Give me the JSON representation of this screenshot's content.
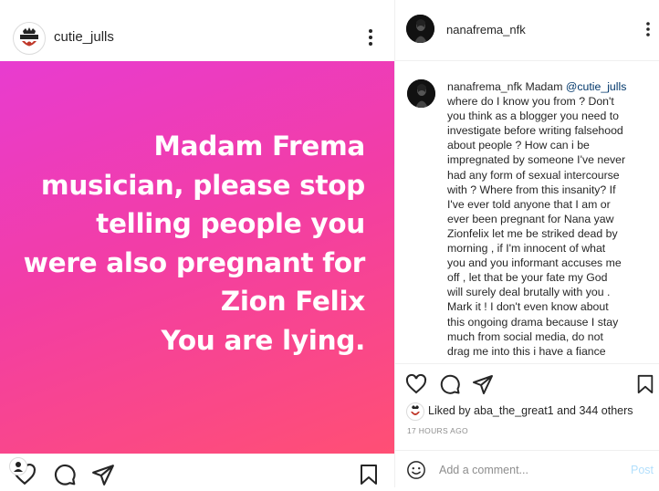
{
  "left": {
    "username": "cutie_julls",
    "avatar_text": "CUTIE",
    "post_text_lines": [
      "Madam Frema",
      "musician, please stop",
      "telling people you",
      "were also pregnant for",
      "Zion Felix",
      "You are lying."
    ]
  },
  "right": {
    "username": "nanafrema_nfk",
    "caption": {
      "username": "nanafrema_nfk",
      "text_before_mention": "Madam",
      "mention": "@cutie_julls",
      "lines": [
        "where do I know you from ? Don't",
        "you think as a blogger you need to",
        "investigate before writing falsehood",
        "about people ? How can i be",
        "impregnated by someone I've never",
        "had any form of sexual intercourse",
        "with ? Where from this insanity? If",
        "I've ever told anyone that I am or",
        "ever been pregnant for Nana yaw",
        "Zionfelix let me be striked dead by",
        "morning , if I'm innocent of what",
        "you and you informant accuses me",
        "off , let that be your fate my God",
        "will surely deal brutally with you .",
        "Mark it ! I don't even know about",
        "this ongoing drama because I stay",
        "much from social media, do not",
        "drag me into this i have a fiance"
      ]
    },
    "likes": {
      "prefix": "Liked by",
      "user": "aba_the_great1",
      "middle": "and",
      "others": "344 others"
    },
    "timestamp": "17 HOURS AGO",
    "comment": {
      "placeholder": "Add a comment...",
      "post_label": "Post"
    }
  },
  "colors": {
    "gradient_start": "#e83cd0",
    "gradient_end": "#ff4f74",
    "mention": "#00376b",
    "post_button": "#b2dffc"
  },
  "icons": [
    "more-icon",
    "heart-icon",
    "comment-icon",
    "share-icon",
    "bookmark-icon",
    "emoji-icon"
  ]
}
